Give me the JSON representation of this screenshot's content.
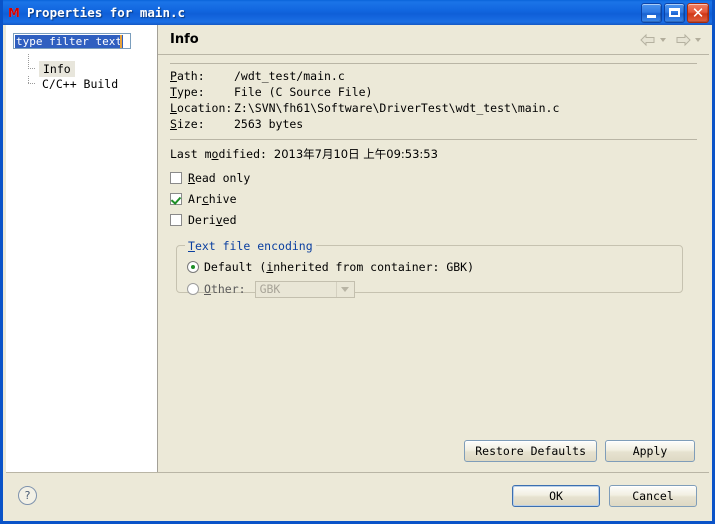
{
  "window": {
    "title": "Properties for main.c",
    "icon": "app-icon",
    "controls": {
      "minimize": "minimize",
      "maximize": "maximize",
      "close": "close"
    }
  },
  "sidebar": {
    "filter": {
      "value": "type filter text",
      "placeholder": "type filter text"
    },
    "tree": [
      {
        "label": "Info",
        "selected": true
      },
      {
        "label": "C/C++ Build",
        "selected": false
      }
    ]
  },
  "page": {
    "title": "Info",
    "nav": {
      "back": "back",
      "forward": "forward"
    },
    "properties": [
      {
        "label": "Path:",
        "mnemonic": "P",
        "value": "/wdt_test/main.c"
      },
      {
        "label": "Type:",
        "mnemonic": "T",
        "value": "File  (C Source File)"
      },
      {
        "label": "Location:",
        "mnemonic": "L",
        "value": "Z:\\SVN\\fh61\\Software\\DriverTest\\wdt_test\\main.c"
      },
      {
        "label": "Size:",
        "mnemonic": "S",
        "value": "2563  bytes"
      }
    ],
    "last_modified": {
      "label": "Last modified:",
      "value": "2013年7月10日 上午09:53:53"
    },
    "checkboxes": [
      {
        "label": "Read only",
        "checked": false
      },
      {
        "label": "Archive",
        "checked": true
      },
      {
        "label": "Derived",
        "checked": false
      }
    ],
    "encoding_group": {
      "title": "Text file encoding",
      "default_option": "Default  (inherited from container: GBK)",
      "default_selected": true,
      "other_option": "Other:",
      "other_selected": false,
      "other_value": "GBK",
      "other_enabled": false
    },
    "buttons": {
      "restore_defaults": "Restore Defaults",
      "apply": "Apply"
    }
  },
  "footer": {
    "help": "?",
    "ok": "OK",
    "cancel": "Cancel"
  },
  "colors": {
    "title_bar": "#1267e0",
    "dialog_bg": "#ece9d8",
    "panel_bg": "#ffffff",
    "group_title": "#0a3fa0",
    "selection": "#2f5fc0",
    "check_green": "#1f8f27",
    "border": "#b9b5a5"
  }
}
